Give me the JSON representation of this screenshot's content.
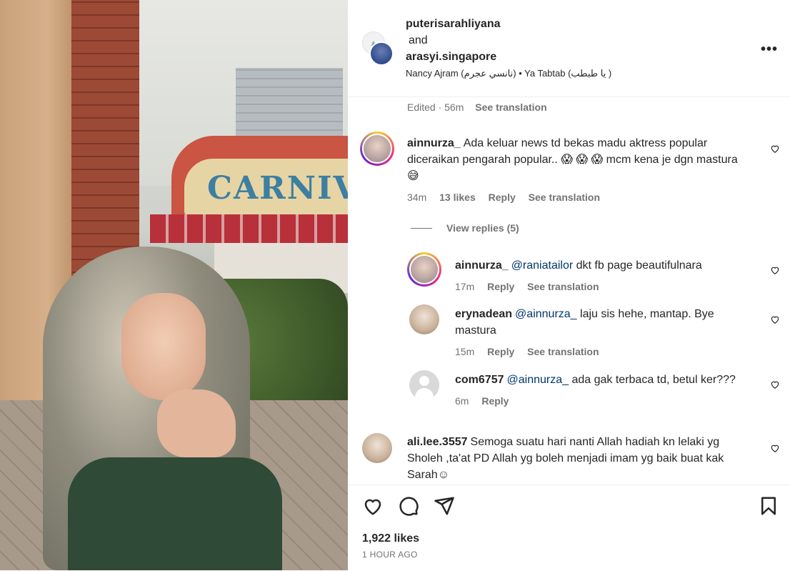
{
  "post": {
    "author_1": "puterisarahliyana",
    "and_text": "and",
    "author_2": "arasyi.singapore",
    "audio": "Nancy Ajram (نانسي عجرم) • Ya Tabtab (يا طبطب )",
    "more_label": "•••",
    "edited_time": "Edited · 56m",
    "see_translation": "See translation",
    "likes": "1,922 likes",
    "posted_ago": "1 HOUR AGO"
  },
  "media": {
    "sign_text": "CARNIVA"
  },
  "comments": [
    {
      "username": "ainnurza_",
      "text": "Ada keluar news td bekas madu aktress popular diceraikan pengarah popular.. 😱 😱 😱  mcm kena je dgn mastura 😅",
      "time": "34m",
      "likes": "13 likes",
      "reply": "Reply",
      "see_translation": "See translation",
      "view_replies": "View replies (5)"
    },
    {
      "username": "ainnurza_",
      "mention": "@raniatailor",
      "text": " dkt fb page beautifulnara",
      "time": "17m",
      "reply": "Reply",
      "see_translation": "See translation"
    },
    {
      "username": "erynadean",
      "mention": "@ainnurza_",
      "text": " laju sis hehe, mantap. Bye mastura",
      "time": "15m",
      "reply": "Reply",
      "see_translation": "See translation"
    },
    {
      "username": "com6757",
      "mention": "@ainnurza_",
      "text": " ada gak terbaca td, betul ker???",
      "time": "6m",
      "reply": "Reply"
    },
    {
      "username": "ali.lee.3557",
      "text": "Semoga suatu hari nanti Allah hadiah kn lelaki yg Sholeh ,ta'at PD Allah yg boleh menjadi imam yg baik buat kak Sarah☺"
    }
  ],
  "colors": {
    "text": "#262626",
    "muted": "#737373",
    "mention": "#00376b",
    "divider": "#efefef"
  },
  "icons": [
    "heart-icon",
    "comment-icon",
    "share-icon",
    "bookmark-icon",
    "more-icon"
  ]
}
